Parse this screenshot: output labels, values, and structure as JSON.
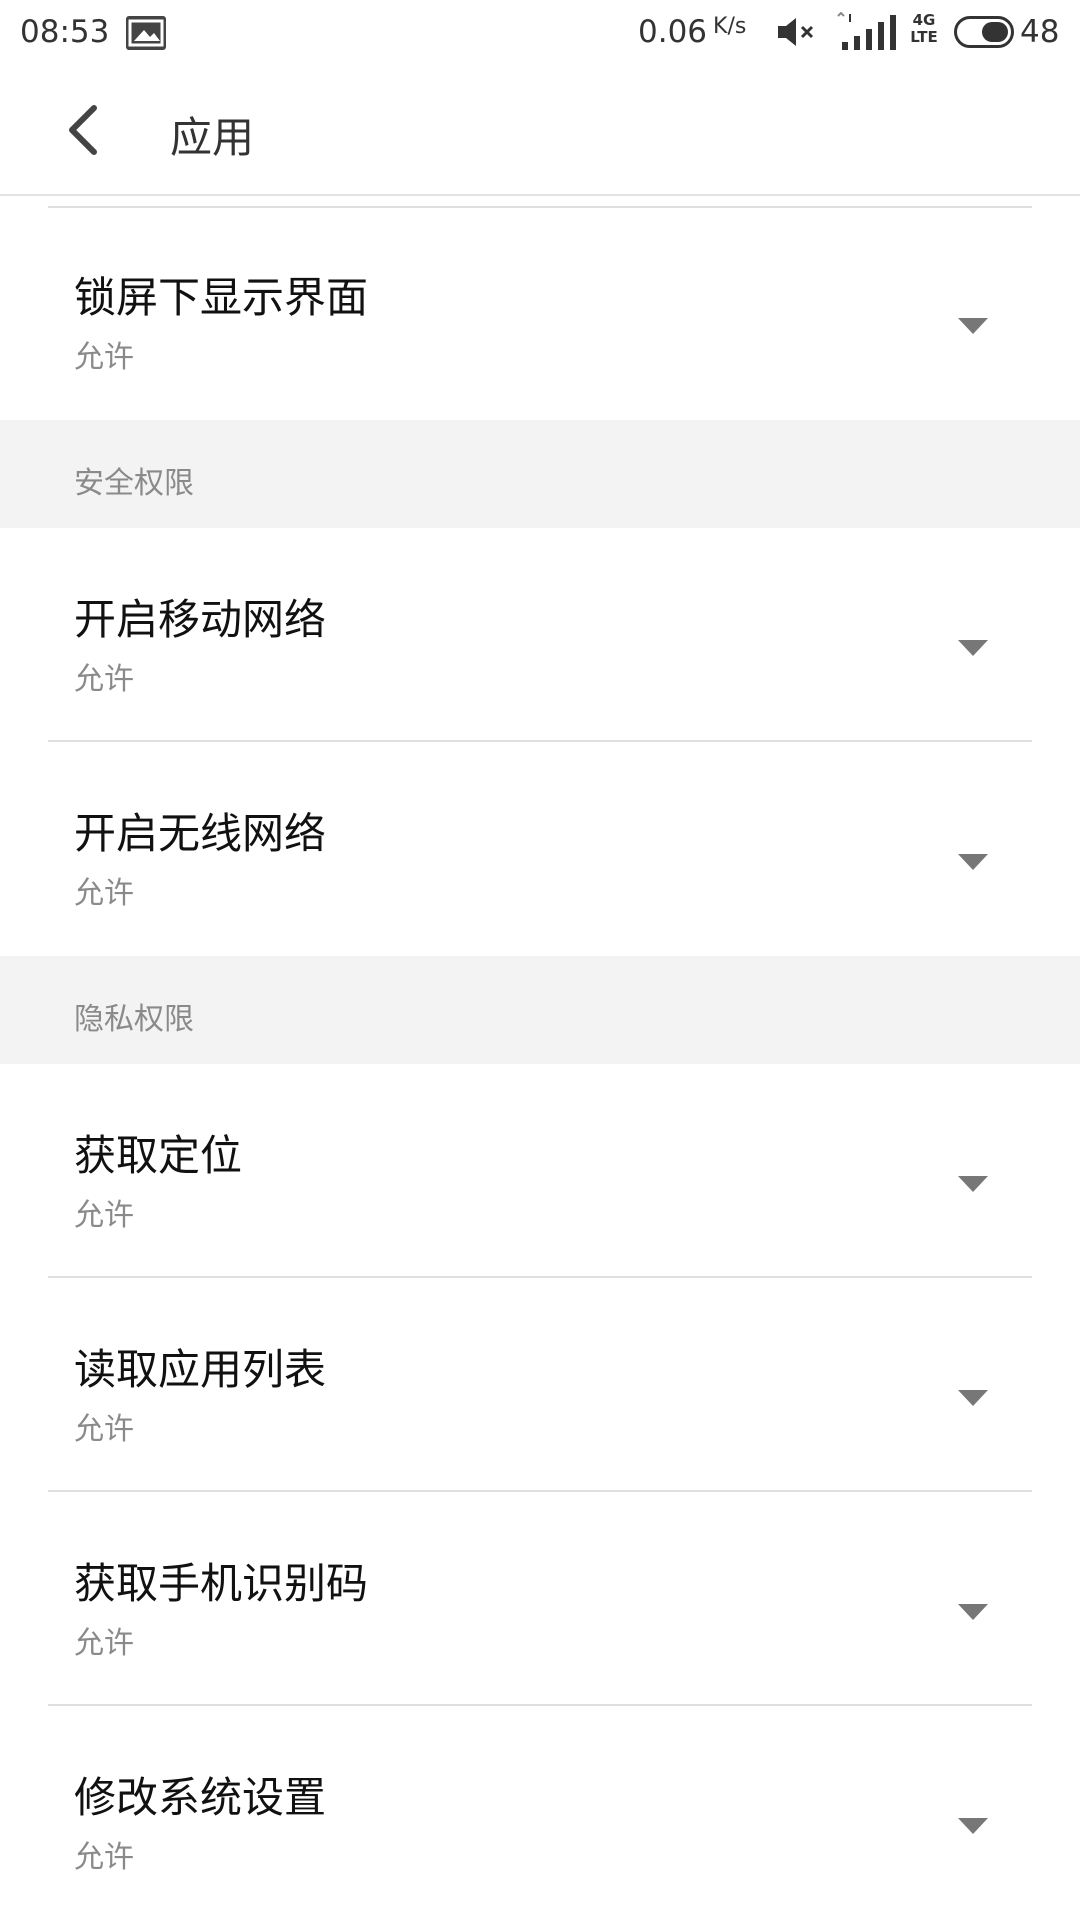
{
  "status_bar": {
    "time": "08:53",
    "speed": "0.06",
    "speed_unit": "K/s",
    "network": "4G",
    "network_sub": "LTE",
    "battery": "48"
  },
  "header": {
    "title": "应用"
  },
  "top_item": {
    "title": "锁屏下显示界面",
    "value": "允许"
  },
  "sections": [
    {
      "label": "安全权限",
      "items": [
        {
          "title": "开启移动网络",
          "value": "允许"
        },
        {
          "title": "开启无线网络",
          "value": "允许"
        }
      ]
    },
    {
      "label": "隐私权限",
      "items": [
        {
          "title": "获取定位",
          "value": "允许"
        },
        {
          "title": "读取应用列表",
          "value": "允许"
        },
        {
          "title": "获取手机识别码",
          "value": "允许"
        },
        {
          "title": "修改系统设置",
          "value": "允许"
        }
      ]
    }
  ],
  "colors": {
    "section_bg": "#f3f3f3",
    "divider": "#e0e0e0",
    "secondary_text": "#8a8a8a"
  }
}
